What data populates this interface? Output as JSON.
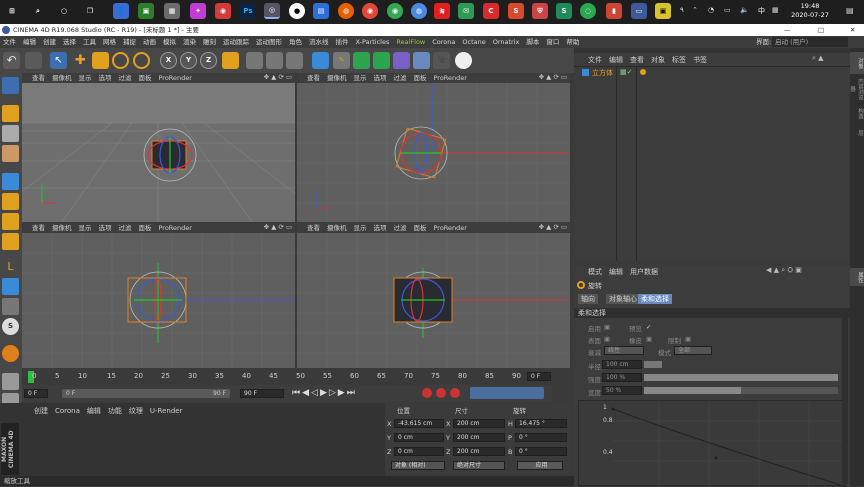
{
  "taskbar": {
    "time": "19:48",
    "date": "2020-07-27",
    "lang": "中",
    "tray_extra": "٩"
  },
  "window": {
    "title": "CINEMA 4D R19.068 Studio (RC - R19) - [未标题 1 *] - 主要",
    "min": "—",
    "max": "□",
    "close": "✕"
  },
  "menu": [
    "文件",
    "编辑",
    "创建",
    "选择",
    "工具",
    "网格",
    "捕捉",
    "动画",
    "模拟",
    "渲染",
    "雕刻",
    "运动跟踪",
    "运动图形",
    "角色",
    "流水线",
    "插件",
    "X-Particles",
    "RealFlow",
    "Corona",
    "Octane",
    "Ornatrix",
    "脚本",
    "窗口",
    "帮助"
  ],
  "layout": {
    "label": "界面:",
    "value": "启动 (用户)"
  },
  "viewport_menu": [
    "查看",
    "摄像机",
    "显示",
    "选项",
    "过滤",
    "面板",
    "ProRender"
  ],
  "timeline": {
    "ticks": [
      "0",
      "5",
      "10",
      "15",
      "20",
      "25",
      "30",
      "35",
      "40",
      "45",
      "50",
      "55",
      "60",
      "65",
      "70",
      "75",
      "80",
      "85",
      "90"
    ],
    "current": "0 F"
  },
  "transport": {
    "start": "0 F",
    "range_start": "0 F",
    "range_end": "90 F",
    "end": "90 F"
  },
  "material_menu": [
    "创建",
    "Corona",
    "编辑",
    "功能",
    "纹理",
    "U-Render"
  ],
  "coords": {
    "headers": [
      "位置",
      "尺寸",
      "旋转"
    ],
    "rows": [
      {
        "pl": "X",
        "pv": "-43.615 cm",
        "sl": "X",
        "sv": "200 cm",
        "rl": "H",
        "rv": "16.475 °"
      },
      {
        "pl": "Y",
        "pv": "0 cm",
        "sl": "Y",
        "sv": "200 cm",
        "rl": "P",
        "rv": "0 °"
      },
      {
        "pl": "Z",
        "pv": "0 cm",
        "sl": "Z",
        "sv": "200 cm",
        "rl": "B",
        "rv": "0 °"
      }
    ],
    "mode": "对象 (相对)",
    "size_mode": "绝对尺寸",
    "apply": "应用"
  },
  "objects": {
    "menu": [
      "文件",
      "编辑",
      "查看",
      "对象",
      "标签",
      "书签"
    ],
    "item": "立方体"
  },
  "attributes": {
    "menu": [
      "模式",
      "编辑",
      "用户数据"
    ],
    "title": "旋转",
    "tabs": [
      "轴向",
      "对象轴心",
      "柔和选择"
    ],
    "section": "柔和选择",
    "enable": "启用",
    "preview": "预览",
    "surface": "表面",
    "rubber": "橡皮",
    "limit": "限制",
    "falloff": "衰减",
    "falloff_val": "线性",
    "mode": "模式",
    "mode_val": "全部",
    "radius": "半径",
    "radius_val": "100 cm",
    "strength": "强度",
    "strength_val": "100 %",
    "width": "宽度",
    "width_val": "50 %",
    "graph_y": [
      "1",
      "0.8",
      "0.4"
    ]
  },
  "right_tabs": [
    "对象",
    "内容浏览器",
    "构造",
    "层",
    "属性"
  ],
  "status": "缩放工具"
}
